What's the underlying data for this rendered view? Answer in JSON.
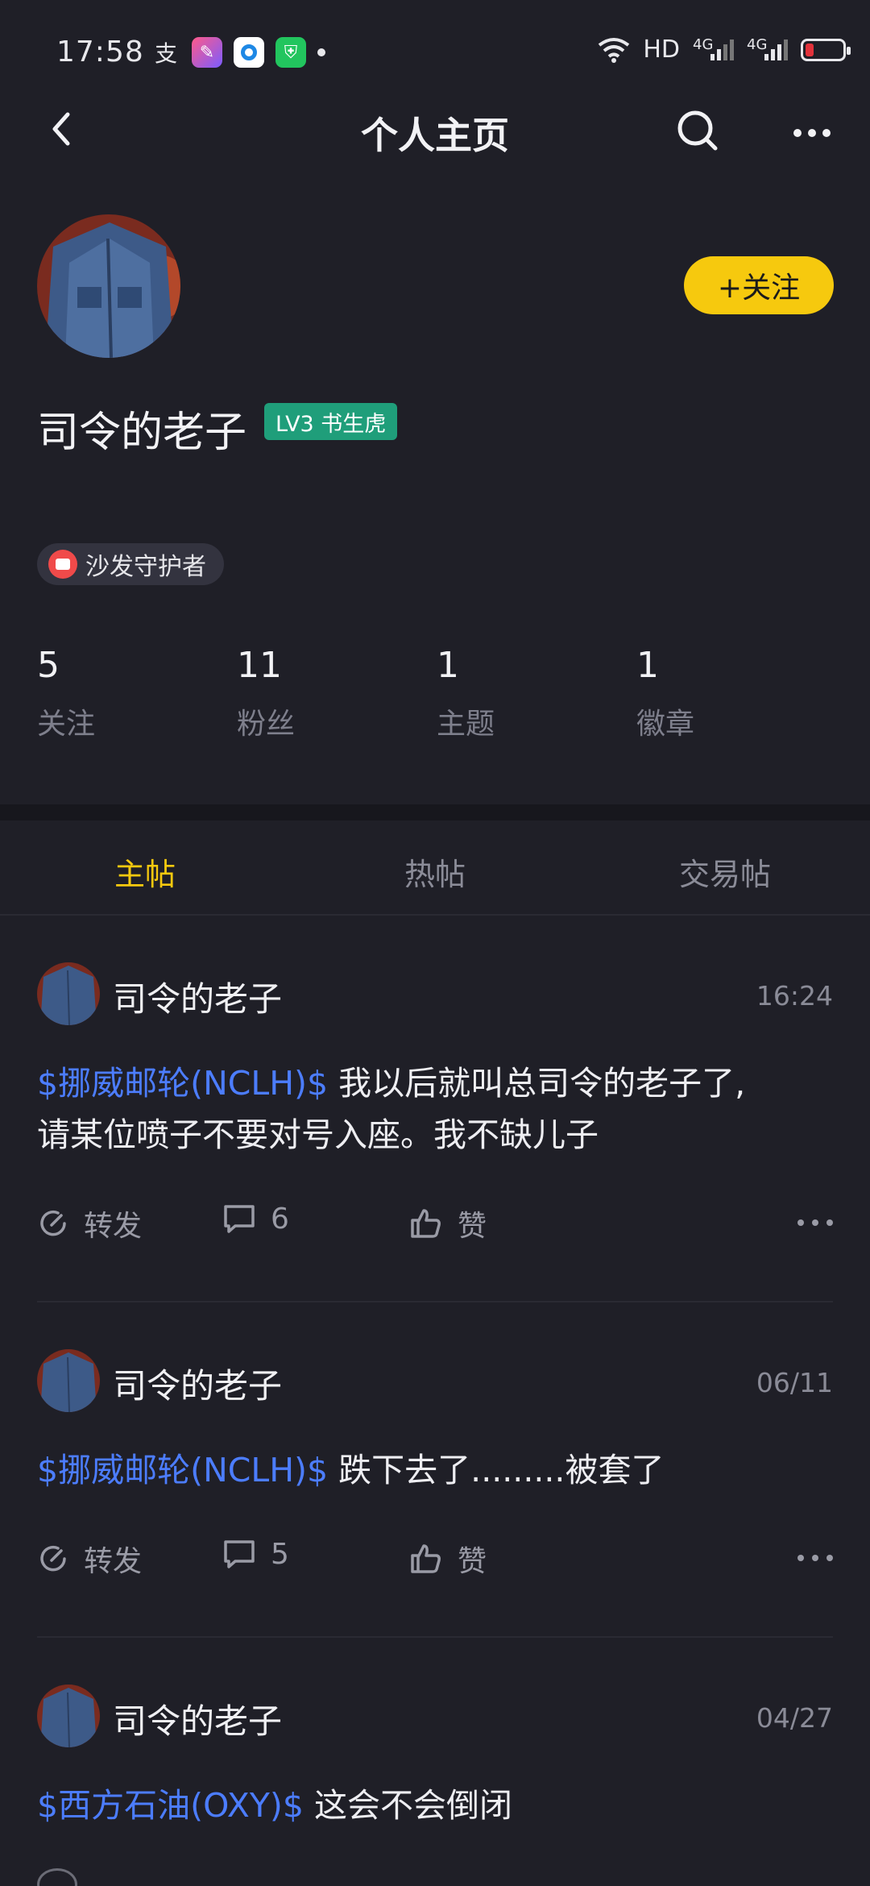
{
  "status_bar": {
    "time": "17:58",
    "network_label": "HD",
    "signal_1": "4G",
    "signal_2": "4G",
    "app_icons": [
      "alipay-icon",
      "app-icon",
      "app-icon",
      "shield-app-icon"
    ]
  },
  "nav": {
    "title": "个人主页",
    "icons": [
      "back-arrow-icon",
      "search-icon",
      "more-horizontal-icon"
    ]
  },
  "profile": {
    "name": "司令的老子",
    "level_badge": "LV3 书生虎",
    "follow_button": "+关注",
    "medal": "沙发守护者",
    "stats": [
      {
        "value": "5",
        "label": "关注"
      },
      {
        "value": "11",
        "label": "粉丝"
      },
      {
        "value": "1",
        "label": "主题"
      },
      {
        "value": "1",
        "label": "徽章"
      }
    ]
  },
  "tabs": [
    {
      "label": "主帖",
      "active": true
    },
    {
      "label": "热帖",
      "active": false
    },
    {
      "label": "交易帖",
      "active": false
    }
  ],
  "posts": [
    {
      "author": "司令的老子",
      "time": "16:24",
      "ticker": "$挪威邮轮(NCLH)$",
      "text_line1": " 我以后就叫总司令的老子了,",
      "text_line2": "请某位喷子不要对号入座。我不缺儿子",
      "repost_label": "转发",
      "comment_count": "6",
      "like_label": "赞"
    },
    {
      "author": "司令的老子",
      "time": "06/11",
      "ticker": "$挪威邮轮(NCLH)$",
      "text_line1": " 跌下去了.........被套了",
      "repost_label": "转发",
      "comment_count": "5",
      "like_label": "赞"
    },
    {
      "author": "司令的老子",
      "time": "04/27",
      "ticker": "$西方石油(OXY)$",
      "text_line1": " 这会不会倒闭"
    }
  ],
  "colors": {
    "background": "#1f1f27",
    "accent_yellow": "#f6c90e",
    "ticker_blue": "#4c7dff",
    "level_green": "#1f9e7a"
  }
}
